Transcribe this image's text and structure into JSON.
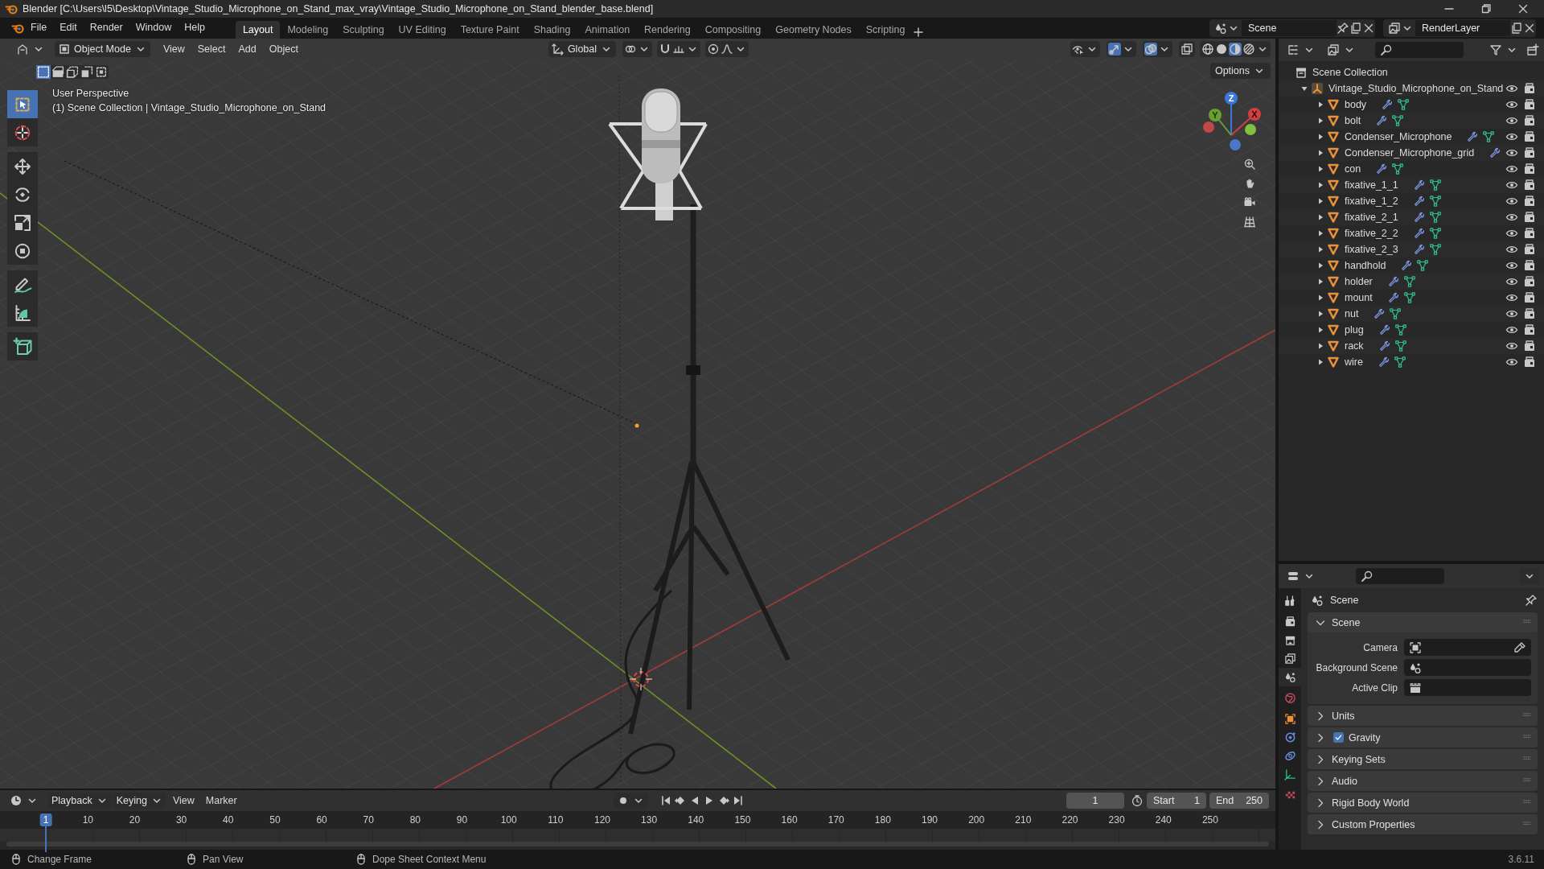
{
  "title_bar": {
    "title": "Blender [C:\\Users\\l5\\Desktop\\Vintage_Studio_Microphone_on_Stand_max_vray\\Vintage_Studio_Microphone_on_Stand_blender_base.blend]"
  },
  "menu": [
    "File",
    "Edit",
    "Render",
    "Window",
    "Help"
  ],
  "workspaces": [
    {
      "label": "Layout",
      "selected": true
    },
    {
      "label": "Modeling",
      "selected": false
    },
    {
      "label": "Sculpting",
      "selected": false
    },
    {
      "label": "UV Editing",
      "selected": false
    },
    {
      "label": "Texture Paint",
      "selected": false
    },
    {
      "label": "Shading",
      "selected": false
    },
    {
      "label": "Animation",
      "selected": false
    },
    {
      "label": "Rendering",
      "selected": false
    },
    {
      "label": "Compositing",
      "selected": false
    },
    {
      "label": "Geometry Nodes",
      "selected": false
    },
    {
      "label": "Scripting",
      "selected": false
    }
  ],
  "scene_selector": {
    "value": "Scene"
  },
  "view_layer_selector": {
    "value": "RenderLayer"
  },
  "viewport": {
    "mode": "Object Mode",
    "menus": [
      "View",
      "Select",
      "Add",
      "Object"
    ],
    "orientation": "Global",
    "options": "Options",
    "overlay_title": "User Perspective",
    "overlay_subtitle": "(1) Scene Collection | Vintage_Studio_Microphone_on_Stand",
    "tools": [
      {
        "kind": "select",
        "selected": true
      },
      {
        "kind": "cursor",
        "selected": false
      },
      {
        "kind": "move",
        "selected": false
      },
      {
        "kind": "rotate",
        "selected": false
      },
      {
        "kind": "scale",
        "selected": false
      },
      {
        "kind": "transform",
        "selected": false
      },
      {
        "kind": "annotate",
        "selected": false
      },
      {
        "kind": "measure",
        "selected": false
      },
      {
        "kind": "add_cube",
        "selected": false
      }
    ],
    "gizmo": {
      "x_label": "X",
      "y_label": "Y",
      "z_label": "Z"
    }
  },
  "timeline": {
    "menus": [
      "Playback",
      "Keying",
      "View",
      "Marker"
    ],
    "current_frame": "1",
    "start_label": "Start",
    "start": "1",
    "end_label": "End",
    "end": "250",
    "ticks": [
      {
        "label": "1",
        "selected": true
      },
      {
        "label": "10",
        "selected": false
      },
      {
        "label": "20",
        "selected": false
      },
      {
        "label": "30",
        "selected": false
      },
      {
        "label": "40",
        "selected": false
      },
      {
        "label": "50",
        "selected": false
      },
      {
        "label": "60",
        "selected": false
      },
      {
        "label": "70",
        "selected": false
      },
      {
        "label": "80",
        "selected": false
      },
      {
        "label": "90",
        "selected": false
      },
      {
        "label": "100",
        "selected": false
      },
      {
        "label": "110",
        "selected": false
      },
      {
        "label": "120",
        "selected": false
      },
      {
        "label": "130",
        "selected": false
      },
      {
        "label": "140",
        "selected": false
      },
      {
        "label": "150",
        "selected": false
      },
      {
        "label": "160",
        "selected": false
      },
      {
        "label": "170",
        "selected": false
      },
      {
        "label": "180",
        "selected": false
      },
      {
        "label": "190",
        "selected": false
      },
      {
        "label": "200",
        "selected": false
      },
      {
        "label": "210",
        "selected": false
      },
      {
        "label": "220",
        "selected": false
      },
      {
        "label": "230",
        "selected": false
      },
      {
        "label": "240",
        "selected": false
      },
      {
        "label": "250",
        "selected": false
      }
    ]
  },
  "outliner": {
    "root": "Scene Collection",
    "collection": {
      "name": "Vintage_Studio_Microphone_on_Stand",
      "expanded": true,
      "children": [
        {
          "name": "body",
          "expanded": false,
          "mesh_data": true
        },
        {
          "name": "bolt",
          "expanded": false,
          "mesh_data": true
        },
        {
          "name": "Condenser_Microphone",
          "expanded": false,
          "mesh_data": true
        },
        {
          "name": "Condenser_Microphone_grid",
          "expanded": false,
          "mesh_data": false
        },
        {
          "name": "con",
          "expanded": false,
          "mesh_data": true
        },
        {
          "name": "fixative_1_1",
          "expanded": false,
          "mesh_data": true
        },
        {
          "name": "fixative_1_2",
          "expanded": false,
          "mesh_data": true
        },
        {
          "name": "fixative_2_1",
          "expanded": false,
          "mesh_data": true
        },
        {
          "name": "fixative_2_2",
          "expanded": false,
          "mesh_data": true
        },
        {
          "name": "fixative_2_3",
          "expanded": false,
          "mesh_data": true
        },
        {
          "name": "handhold",
          "expanded": false,
          "mesh_data": true
        },
        {
          "name": "holder",
          "expanded": false,
          "mesh_data": true
        },
        {
          "name": "mount",
          "expanded": false,
          "mesh_data": true
        },
        {
          "name": "nut",
          "expanded": false,
          "mesh_data": true
        },
        {
          "name": "plug",
          "expanded": false,
          "mesh_data": true
        },
        {
          "name": "rack",
          "expanded": false,
          "mesh_data": true
        },
        {
          "name": "wire",
          "expanded": false,
          "mesh_data": true
        }
      ]
    }
  },
  "properties": {
    "tabs": [
      {
        "kind": "tool",
        "selected": false
      },
      {
        "kind": "render",
        "selected": false
      },
      {
        "kind": "output",
        "selected": false
      },
      {
        "kind": "view_layer",
        "selected": false
      },
      {
        "kind": "scene",
        "selected": true
      },
      {
        "kind": "world",
        "selected": false
      },
      {
        "kind": "object",
        "selected": false
      },
      {
        "kind": "physics",
        "selected": false
      },
      {
        "kind": "constraints",
        "selected": false
      },
      {
        "kind": "data",
        "selected": false
      },
      {
        "kind": "texture",
        "selected": false
      }
    ],
    "context": "Scene",
    "panels": [
      {
        "kind": "plain",
        "title": "Scene",
        "expanded": true,
        "fields": [
          {
            "kind": "object",
            "label": "Camera"
          },
          {
            "kind": "scene",
            "label": "Background Scene"
          },
          {
            "kind": "clip",
            "label": "Active Clip"
          }
        ]
      },
      {
        "kind": "plain",
        "title": "Units",
        "expanded": false
      },
      {
        "kind": "toggle",
        "title": "Gravity",
        "expanded": false,
        "checked": true
      },
      {
        "kind": "plain",
        "title": "Keying Sets",
        "expanded": false
      },
      {
        "kind": "plain",
        "title": "Audio",
        "expanded": false
      },
      {
        "kind": "plain",
        "title": "Rigid Body World",
        "expanded": false
      },
      {
        "kind": "plain",
        "title": "Custom Properties",
        "expanded": false
      }
    ]
  },
  "status_bar": {
    "hints": [
      "Change Frame",
      "Pan View",
      "Dope Sheet Context Menu"
    ],
    "version": "3.6.11"
  }
}
